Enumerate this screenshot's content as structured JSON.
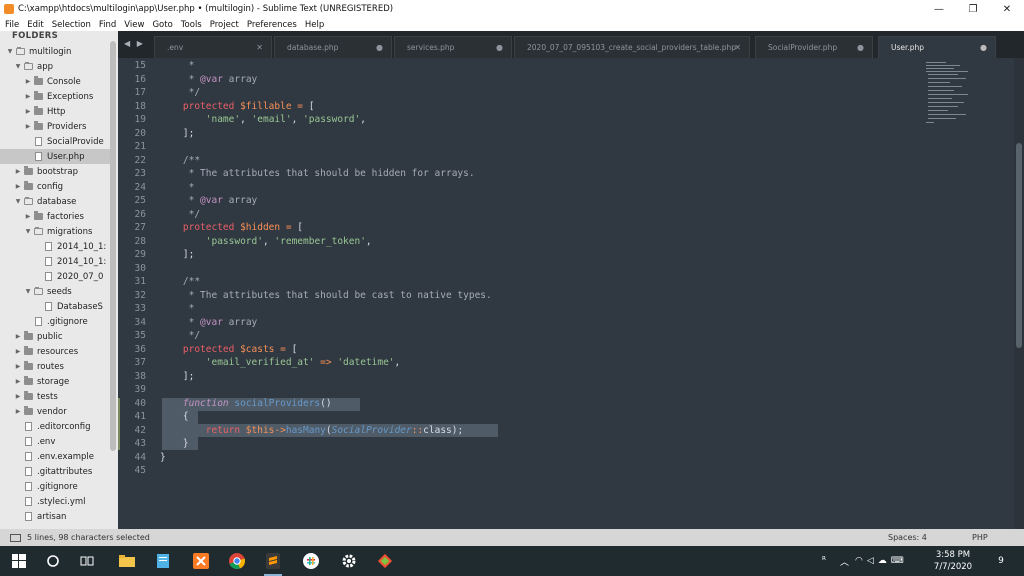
{
  "window": {
    "title": "C:\\xampp\\htdocs\\multilogin\\app\\User.php • (multilogin) - Sublime Text (UNREGISTERED)",
    "minimize": "—",
    "maximize": "❐",
    "close": "✕"
  },
  "menu": [
    "File",
    "Edit",
    "Selection",
    "Find",
    "View",
    "Goto",
    "Tools",
    "Project",
    "Preferences",
    "Help"
  ],
  "sidebar": {
    "header": "FOLDERS",
    "items": [
      {
        "label": "multilogin",
        "type": "folder-open",
        "arrow": "▼"
      },
      {
        "label": "app",
        "type": "folder-open",
        "arrow": "▼"
      },
      {
        "label": "Console",
        "type": "folder",
        "arrow": "▶"
      },
      {
        "label": "Exceptions",
        "type": "folder",
        "arrow": "▶"
      },
      {
        "label": "Http",
        "type": "folder",
        "arrow": "▶"
      },
      {
        "label": "Providers",
        "type": "folder",
        "arrow": "▶"
      },
      {
        "label": "SocialProvide",
        "type": "file",
        "arrow": ""
      },
      {
        "label": "User.php",
        "type": "file",
        "arrow": "",
        "selected": true
      },
      {
        "label": "bootstrap",
        "type": "folder",
        "arrow": "▶"
      },
      {
        "label": "config",
        "type": "folder",
        "arrow": "▶"
      },
      {
        "label": "database",
        "type": "folder-open",
        "arrow": "▼"
      },
      {
        "label": "factories",
        "type": "folder",
        "arrow": "▶"
      },
      {
        "label": "migrations",
        "type": "folder-open",
        "arrow": "▼"
      },
      {
        "label": "2014_10_1:",
        "type": "file",
        "arrow": ""
      },
      {
        "label": "2014_10_1:",
        "type": "file",
        "arrow": ""
      },
      {
        "label": "2020_07_0",
        "type": "file",
        "arrow": ""
      },
      {
        "label": "seeds",
        "type": "folder-open",
        "arrow": "▼"
      },
      {
        "label": "DatabaseS",
        "type": "file",
        "arrow": ""
      },
      {
        "label": ".gitignore",
        "type": "file",
        "arrow": ""
      },
      {
        "label": "public",
        "type": "folder",
        "arrow": "▶"
      },
      {
        "label": "resources",
        "type": "folder",
        "arrow": "▶"
      },
      {
        "label": "routes",
        "type": "folder",
        "arrow": "▶"
      },
      {
        "label": "storage",
        "type": "folder",
        "arrow": "▶"
      },
      {
        "label": "tests",
        "type": "folder",
        "arrow": "▶"
      },
      {
        "label": "vendor",
        "type": "folder",
        "arrow": "▶"
      },
      {
        "label": ".editorconfig",
        "type": "file",
        "arrow": ""
      },
      {
        "label": ".env",
        "type": "file",
        "arrow": ""
      },
      {
        "label": ".env.example",
        "type": "file",
        "arrow": ""
      },
      {
        "label": ".gitattributes",
        "type": "file",
        "arrow": ""
      },
      {
        "label": ".gitignore",
        "type": "file",
        "arrow": ""
      },
      {
        "label": ".styleci.yml",
        "type": "file",
        "arrow": ""
      },
      {
        "label": "artisan",
        "type": "file",
        "arrow": ""
      }
    ]
  },
  "tabs": {
    "nav": "◀ ▶",
    "items": [
      {
        "label": ".env",
        "close": "✕",
        "active": false
      },
      {
        "label": "database.php",
        "close": "●",
        "active": false
      },
      {
        "label": "services.php",
        "close": "●",
        "active": false
      },
      {
        "label": "2020_07_07_095103_create_social_providers_table.php",
        "close": "✕",
        "active": false
      },
      {
        "label": "SocialProvider.php",
        "close": "●",
        "active": false
      },
      {
        "label": "User.php",
        "close": "●",
        "active": true
      }
    ]
  },
  "editor": {
    "lines": [
      {
        "n": "15",
        "tokens": [
          [
            "c-cm",
            "     *"
          ]
        ]
      },
      {
        "n": "16",
        "tokens": [
          [
            "c-cm",
            "     * "
          ],
          [
            "c-at",
            "@var"
          ],
          [
            "c-cm",
            " array"
          ]
        ]
      },
      {
        "n": "17",
        "tokens": [
          [
            "c-cm",
            "     */"
          ]
        ]
      },
      {
        "n": "18",
        "tokens": [
          [
            "c-kw",
            "    protected "
          ],
          [
            "c-var",
            "$fillable"
          ],
          [
            "c-op",
            " = "
          ],
          [
            "c-punc",
            "["
          ]
        ]
      },
      {
        "n": "19",
        "tokens": [
          [
            "c-str",
            "        'name'"
          ],
          [
            "c-punc",
            ", "
          ],
          [
            "c-str",
            "'email'"
          ],
          [
            "c-punc",
            ", "
          ],
          [
            "c-str",
            "'password'"
          ],
          [
            "c-punc",
            ","
          ]
        ]
      },
      {
        "n": "20",
        "tokens": [
          [
            "c-punc",
            "    ];"
          ]
        ]
      },
      {
        "n": "21",
        "tokens": []
      },
      {
        "n": "22",
        "tokens": [
          [
            "c-cm",
            "    /**"
          ]
        ]
      },
      {
        "n": "23",
        "tokens": [
          [
            "c-cm",
            "     * The attributes that should be hidden for arrays."
          ]
        ]
      },
      {
        "n": "24",
        "tokens": [
          [
            "c-cm",
            "     *"
          ]
        ]
      },
      {
        "n": "25",
        "tokens": [
          [
            "c-cm",
            "     * "
          ],
          [
            "c-at",
            "@var"
          ],
          [
            "c-cm",
            " array"
          ]
        ]
      },
      {
        "n": "26",
        "tokens": [
          [
            "c-cm",
            "     */"
          ]
        ]
      },
      {
        "n": "27",
        "tokens": [
          [
            "c-kw",
            "    protected "
          ],
          [
            "c-var",
            "$hidden"
          ],
          [
            "c-op",
            " = "
          ],
          [
            "c-punc",
            "["
          ]
        ]
      },
      {
        "n": "28",
        "tokens": [
          [
            "c-str",
            "        'password'"
          ],
          [
            "c-punc",
            ", "
          ],
          [
            "c-str",
            "'remember_token'"
          ],
          [
            "c-punc",
            ","
          ]
        ]
      },
      {
        "n": "29",
        "tokens": [
          [
            "c-punc",
            "    ];"
          ]
        ]
      },
      {
        "n": "30",
        "tokens": []
      },
      {
        "n": "31",
        "tokens": [
          [
            "c-cm",
            "    /**"
          ]
        ]
      },
      {
        "n": "32",
        "tokens": [
          [
            "c-cm",
            "     * The attributes that should be cast to native types."
          ]
        ]
      },
      {
        "n": "33",
        "tokens": [
          [
            "c-cm",
            "     *"
          ]
        ]
      },
      {
        "n": "34",
        "tokens": [
          [
            "c-cm",
            "     * "
          ],
          [
            "c-at",
            "@var"
          ],
          [
            "c-cm",
            " array"
          ]
        ]
      },
      {
        "n": "35",
        "tokens": [
          [
            "c-cm",
            "     */"
          ]
        ]
      },
      {
        "n": "36",
        "tokens": [
          [
            "c-kw",
            "    protected "
          ],
          [
            "c-var",
            "$casts"
          ],
          [
            "c-op",
            " = "
          ],
          [
            "c-punc",
            "["
          ]
        ]
      },
      {
        "n": "37",
        "tokens": [
          [
            "c-str",
            "        'email_verified_at'"
          ],
          [
            "c-op",
            " => "
          ],
          [
            "c-str",
            "'datetime'"
          ],
          [
            "c-punc",
            ","
          ]
        ]
      },
      {
        "n": "38",
        "tokens": [
          [
            "c-punc",
            "    ];"
          ]
        ]
      },
      {
        "n": "39",
        "tokens": []
      },
      {
        "n": "40",
        "tokens": [
          [
            "c-kwi",
            "    function "
          ],
          [
            "c-fn",
            "socialProviders"
          ],
          [
            "c-punc",
            "()"
          ]
        ]
      },
      {
        "n": "41",
        "tokens": [
          [
            "c-punc",
            "    {"
          ]
        ]
      },
      {
        "n": "42",
        "tokens": [
          [
            "c-kw",
            "        return "
          ],
          [
            "c-var",
            "$this"
          ],
          [
            "c-op",
            "->"
          ],
          [
            "c-fn",
            "hasMany"
          ],
          [
            "c-punc",
            "("
          ],
          [
            "c-cls",
            "SocialProvider"
          ],
          [
            "c-op",
            "::"
          ],
          [
            "c-punc",
            "class);"
          ]
        ]
      },
      {
        "n": "43",
        "tokens": [
          [
            "c-punc",
            "    }"
          ]
        ]
      },
      {
        "n": "44",
        "tokens": [
          [
            "c-punc",
            "}"
          ]
        ]
      },
      {
        "n": "45",
        "tokens": []
      }
    ]
  },
  "statusbar": {
    "selection": "5 lines, 98 characters selected",
    "spaces": "Spaces: 4",
    "syntax": "PHP"
  },
  "taskbar": {
    "items": [
      "windows-start-icon",
      "cortana-search-icon",
      "task-view-icon",
      "file-explorer-icon",
      "notepad-icon",
      "xampp-icon",
      "chrome-icon",
      "sublime-text-icon",
      "slack-icon",
      "settings-icon",
      "git-icon"
    ],
    "time": "3:58 PM",
    "date": "7/7/2020",
    "notifications": "9"
  }
}
